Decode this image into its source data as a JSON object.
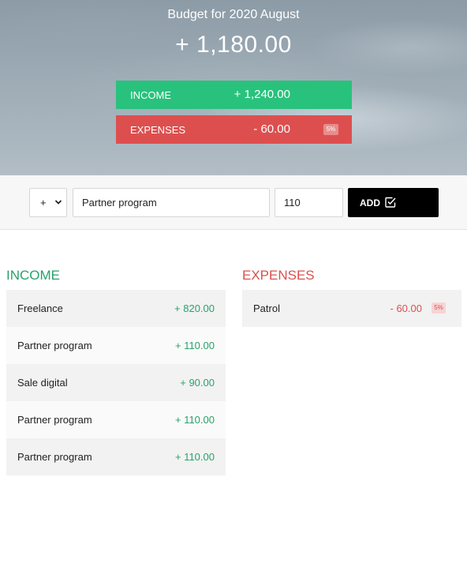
{
  "header": {
    "title": "Budget for 2020 August",
    "total": "+ 1,180.00"
  },
  "summary": {
    "income": {
      "label": "INCOME",
      "value": "+ 1,240.00"
    },
    "expenses": {
      "label": "EXPENSES",
      "value": "- 60.00",
      "percentage": "5%"
    }
  },
  "add_form": {
    "type_value": "+",
    "description_value": "Partner program",
    "amount_value": "110",
    "add_label": "ADD",
    "add_icon": "check-square-icon"
  },
  "income_list": {
    "title": "INCOME",
    "items": [
      {
        "description": "Freelance",
        "value": "+ 820.00"
      },
      {
        "description": "Partner program",
        "value": "+ 110.00"
      },
      {
        "description": "Sale digital",
        "value": "+ 90.00"
      },
      {
        "description": "Partner program",
        "value": "+ 110.00"
      },
      {
        "description": "Partner program",
        "value": "+ 110.00"
      }
    ]
  },
  "expenses_list": {
    "title": "EXPENSES",
    "items": [
      {
        "description": "Patrol",
        "value": "- 60.00",
        "percentage": "5%"
      }
    ]
  },
  "colors": {
    "income": "#28c27d",
    "expenses": "#dd4f4f",
    "button": "#000000"
  }
}
